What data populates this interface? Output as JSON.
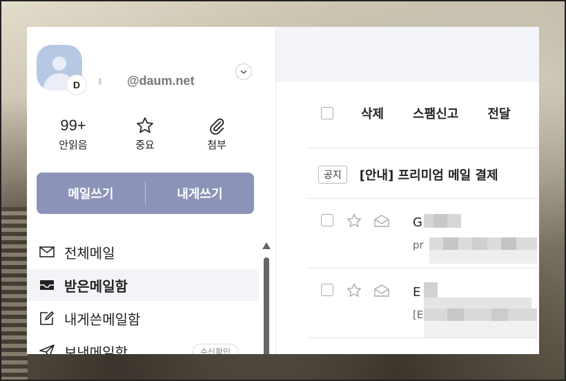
{
  "account": {
    "avatar_badge": "D",
    "domain": "@daum.net"
  },
  "stats": {
    "unread": {
      "value": "99+",
      "label": "안읽음",
      "icon": "envelope-count"
    },
    "important": {
      "label": "중요",
      "icon": "star-icon"
    },
    "attachment": {
      "label": "첨부",
      "icon": "paperclip-icon"
    }
  },
  "compose": {
    "write_label": "메일쓰기",
    "write_to_me_label": "내게쓰기"
  },
  "folders": [
    {
      "label": "전체메일",
      "icon": "mail-icon",
      "active": false
    },
    {
      "label": "받은메일함",
      "icon": "inbox-icon",
      "active": true
    },
    {
      "label": "내게쓴메일함",
      "icon": "edit-icon",
      "active": false
    },
    {
      "label": "보낸메일함",
      "icon": "send-icon",
      "active": false,
      "pill": "수신확인"
    }
  ],
  "toolbar": {
    "delete_label": "삭제",
    "spam_label": "스팸신고",
    "forward_label": "전달"
  },
  "notice": {
    "tag": "공지",
    "subject": "[안내] 프리미엄 메일 결제"
  },
  "mails": [
    {
      "sender": "G",
      "preview": "pr"
    },
    {
      "sender": "E",
      "preview": "[E"
    }
  ],
  "colors": {
    "compose_bg": "#8b94b8",
    "active_folder_bg": "#f3f4f8",
    "topbar_bg": "#f3f5fb"
  }
}
